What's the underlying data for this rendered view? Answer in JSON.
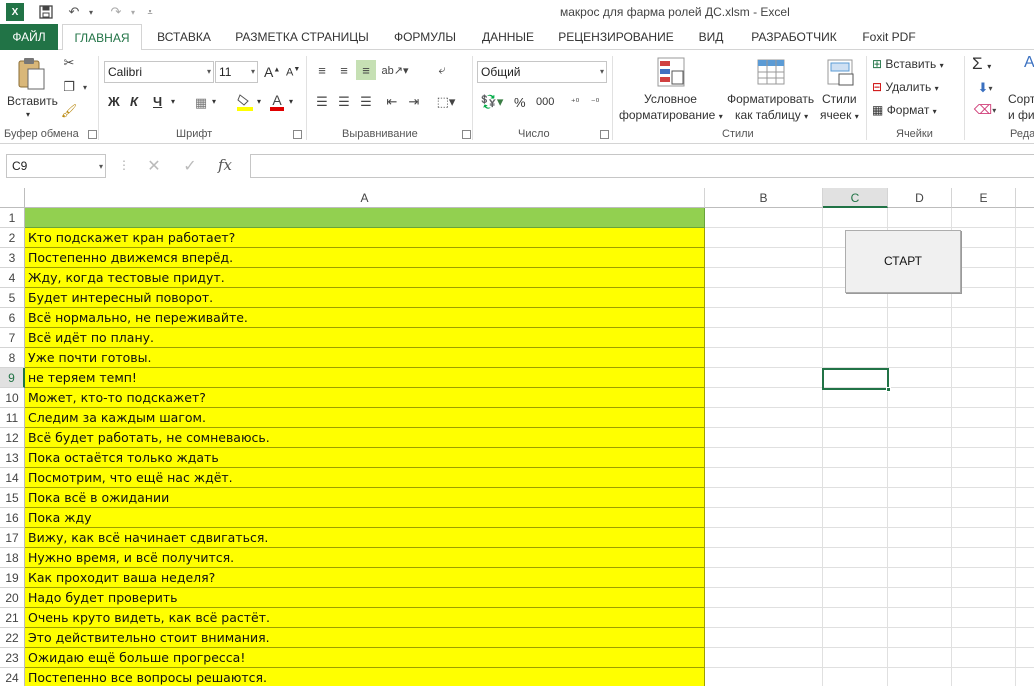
{
  "window": {
    "title": "макрос для фарма ролей ДС.xlsm - Excel"
  },
  "quick_access": {
    "app_icon": "excel-icon",
    "save": "save-icon",
    "undo": "undo-icon",
    "redo": "redo-icon",
    "customize": "customize-icon"
  },
  "tabs": [
    "ФАЙЛ",
    "ГЛАВНАЯ",
    "ВСТАВКА",
    "РАЗМЕТКА СТРАНИЦЫ",
    "ФОРМУЛЫ",
    "ДАННЫЕ",
    "РЕЦЕНЗИРОВАНИЕ",
    "ВИД",
    "РАЗРАБОТЧИК",
    "Foxit PDF"
  ],
  "ribbon": {
    "clipboard": {
      "label": "Буфер обмена",
      "paste": "Вставить"
    },
    "font": {
      "label": "Шрифт",
      "name": "Calibri",
      "size": "11",
      "bold": "Ж",
      "italic": "К",
      "underline": "Ч",
      "grow": "A",
      "shrink": "A",
      "font_color": "A"
    },
    "alignment": {
      "label": "Выравнивание"
    },
    "number": {
      "label": "Число",
      "format": "Общий",
      "percent": "%",
      "thousands": "000"
    },
    "styles": {
      "label": "Стили",
      "conditional_1": "Условное",
      "conditional_2": "форматирование",
      "table_1": "Форматировать",
      "table_2": "как таблицу",
      "cell_styles_1": "Стили",
      "cell_styles_2": "ячеек"
    },
    "cells": {
      "label": "Ячейки",
      "insert": "Вставить",
      "delete": "Удалить",
      "format": "Формат"
    },
    "editing": {
      "label": "Реда",
      "sort_1": "Сорт",
      "sort_2": "и фи",
      "sigma": "Σ"
    }
  },
  "formula_bar": {
    "name_box": "C9",
    "fx": "fx",
    "formula": ""
  },
  "columns": [
    "A",
    "B",
    "C",
    "D",
    "E"
  ],
  "selected_column": "C",
  "selected_row": 9,
  "rows": [
    {
      "n": "1",
      "a": ""
    },
    {
      "n": "2",
      "a": "Кто подскажет кран работает?"
    },
    {
      "n": "3",
      "a": "Постепенно движемся вперёд."
    },
    {
      "n": "4",
      "a": "Жду, когда тестовые придут."
    },
    {
      "n": "5",
      "a": "Будет интересный поворот."
    },
    {
      "n": "6",
      "a": "Всё нормально, не переживайте."
    },
    {
      "n": "7",
      "a": "Всё идёт по плану."
    },
    {
      "n": "8",
      "a": "Уже почти готовы."
    },
    {
      "n": "9",
      "a": "не теряем темп!"
    },
    {
      "n": "10",
      "a": "Может, кто-то подскажет?"
    },
    {
      "n": "11",
      "a": "Следим за каждым шагом."
    },
    {
      "n": "12",
      "a": "Всё будет работать, не сомневаюсь."
    },
    {
      "n": "13",
      "a": "Пока остаётся только ждать"
    },
    {
      "n": "14",
      "a": "Посмотрим, что ещё нас ждёт."
    },
    {
      "n": "15",
      "a": "Пока всё в ожидании"
    },
    {
      "n": "16",
      "a": "Пока жду"
    },
    {
      "n": "17",
      "a": "Вижу, как всё начинает сдвигаться."
    },
    {
      "n": "18",
      "a": "Нужно время, и всё получится."
    },
    {
      "n": "19",
      "a": "Как проходит ваша неделя?"
    },
    {
      "n": "20",
      "a": "Надо будет проверить"
    },
    {
      "n": "21",
      "a": "Очень круто видеть, как всё растёт."
    },
    {
      "n": "22",
      "a": "Это действительно стоит внимания."
    },
    {
      "n": "23",
      "a": "Ожидаю ещё больше прогресса!"
    },
    {
      "n": "24",
      "a": "Постепенно все вопросы решаются."
    }
  ],
  "start_button": "СТАРТ",
  "colors": {
    "accent": "#217346",
    "yellow": "#ffff00",
    "green_header": "#92d050"
  }
}
